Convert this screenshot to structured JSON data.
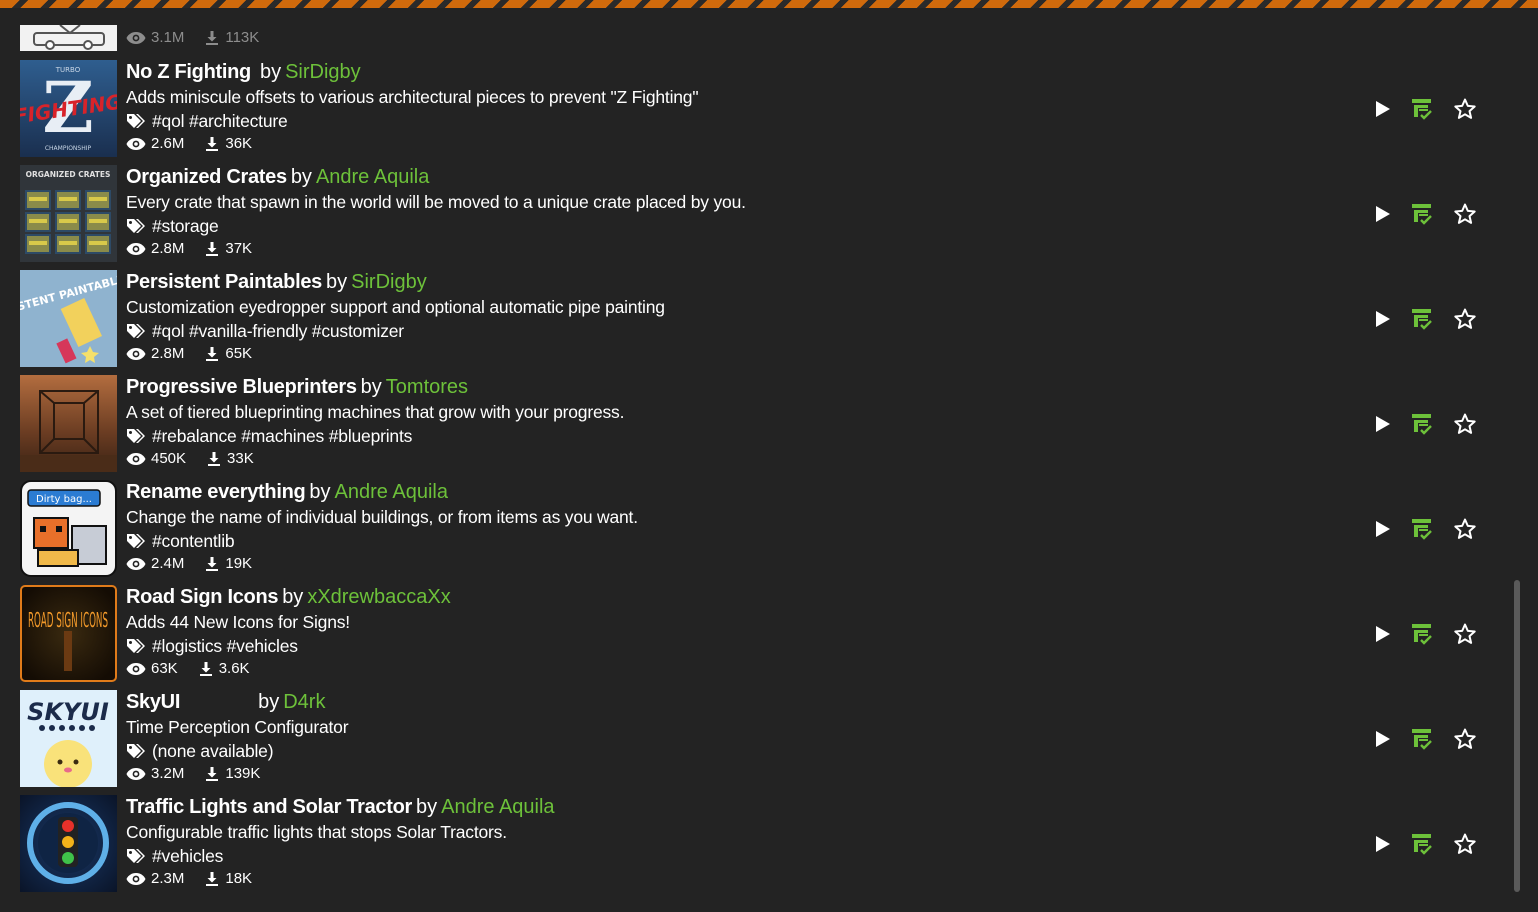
{
  "colors": {
    "accent_green": "#6dc13a",
    "hazard_orange": "#d06a0c",
    "background": "#232323"
  },
  "icons": {
    "views": "eye-icon",
    "downloads": "download-icon",
    "tags": "tag-icon",
    "play": "play-icon",
    "library": "library-add-icon",
    "favorite": "star-icon"
  },
  "partial_row": {
    "views": "3.1M",
    "downloads": "113K"
  },
  "mods": [
    {
      "title": "No Z Fighting",
      "by": "by",
      "author": "SirDigby",
      "description": "Adds miniscule offsets to various architectural pieces to prevent \"Z Fighting\"",
      "tags": "#qol #architecture",
      "views": "2.6M",
      "downloads": "36K",
      "thumb_text": "FIGHTING"
    },
    {
      "title": "Organized Crates",
      "by": "by",
      "author": "Andre Aquila",
      "description": "Every crate that spawn in the world will be moved to a unique crate placed by you.",
      "tags": "#storage",
      "views": "2.8M",
      "downloads": "37K",
      "thumb_text": "ORGANIZED CRATES"
    },
    {
      "title": "Persistent Paintables",
      "by": "by",
      "author": "SirDigby",
      "description": "Customization eyedropper support and optional automatic pipe painting",
      "tags": "#qol #vanilla-friendly #customizer",
      "views": "2.8M",
      "downloads": "65K",
      "thumb_text": "PERSISTENT PAINTABLES"
    },
    {
      "title": "Progressive Blueprinters",
      "by": "by",
      "author": "Tomtores",
      "description": "A set of tiered blueprinting machines that grow with your progress.",
      "tags": "#rebalance #machines #blueprints",
      "views": "450K",
      "downloads": "33K",
      "thumb_text": ""
    },
    {
      "title": "Rename everything",
      "by": "by",
      "author": "Andre Aquila",
      "description": "Change the name of individual buildings, or from items as you want.",
      "tags": "#contentlib",
      "views": "2.4M",
      "downloads": "19K",
      "thumb_text": "Dirty bag..."
    },
    {
      "title": "Road Sign Icons",
      "by": "by",
      "author": "xXdrewbaccaXx",
      "description": "Adds 44 New Icons for Signs!",
      "tags": "#logistics #vehicles",
      "views": "63K",
      "downloads": "3.6K",
      "thumb_text": "ROAD SIGN ICONS"
    },
    {
      "title": "SkyUI",
      "by": "by",
      "author": "D4rk",
      "description": "Time Perception Configurator",
      "tags": "(none available)",
      "views": "3.2M",
      "downloads": "139K",
      "thumb_text": "SKYUI"
    },
    {
      "title": "Traffic Lights and Solar Tractor",
      "by": "by",
      "author": "Andre Aquila",
      "description": "Configurable traffic lights that stops Solar Tractors.",
      "tags": "#vehicles",
      "views": "2.3M",
      "downloads": "18K",
      "thumb_text": ""
    }
  ]
}
